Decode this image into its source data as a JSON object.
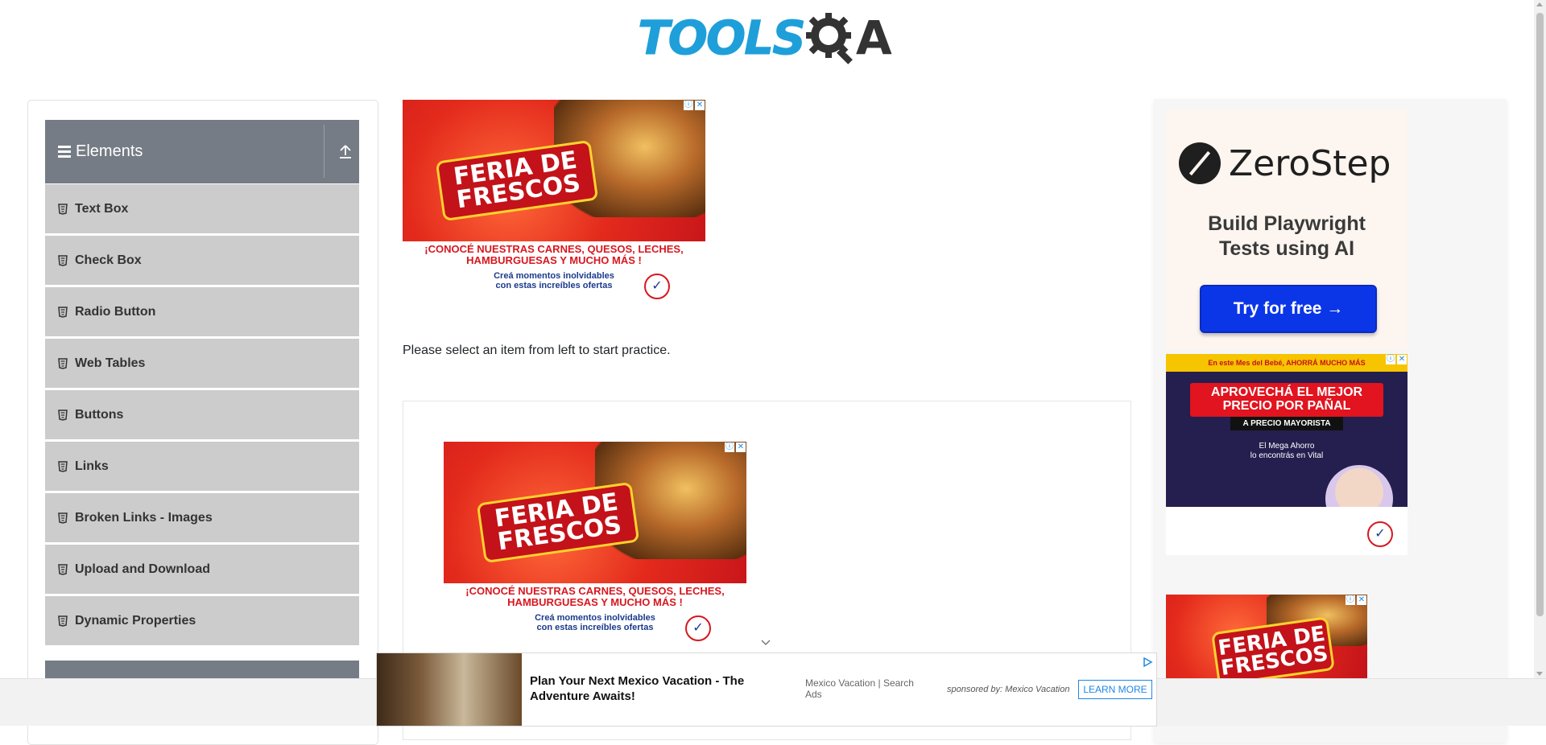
{
  "header": {
    "logo_tools": "TOOLS",
    "logo_qa": "A",
    "logo_alt": "TOOLSQA"
  },
  "sidebar": {
    "group_title": "Elements",
    "items": [
      {
        "label": "Text Box"
      },
      {
        "label": "Check Box"
      },
      {
        "label": "Radio Button"
      },
      {
        "label": "Web Tables"
      },
      {
        "label": "Buttons"
      },
      {
        "label": "Links"
      },
      {
        "label": "Broken Links - Images"
      },
      {
        "label": "Upload and Download"
      },
      {
        "label": "Dynamic Properties"
      }
    ]
  },
  "main": {
    "practice_text": "Please select an item from left to start practice."
  },
  "ads": {
    "feria": {
      "title_line1": "FERIA DE",
      "title_line2": "FRESCOS",
      "tagline": "¡CONOCÉ NUESTRAS CARNES, QUESOS, LECHES, HAMBURGUESAS Y MUCHO MÁS !",
      "subline_1": "Creá momentos inolvidables",
      "subline_2": "con estas increíbles ofertas"
    },
    "zerostep": {
      "name": "ZeroStep",
      "tagline_1": "Build Playwright",
      "tagline_2": "Tests using AI",
      "button": "Try for free →"
    },
    "bebe": {
      "top": "En este Mes del Bebé, AHORRÁ MUCHO MÁS",
      "headline_1": "APROVECHÁ EL MEJOR",
      "headline_2": "PRECIO POR PAÑAL",
      "sub": "A PRECIO MAYORISTA",
      "text_1": "El Mega Ahorro",
      "text_2": "lo encontrás en Vital"
    },
    "bottom": {
      "headline": "Plan Your Next Mexico Vacation - The Adventure Awaits!",
      "search": "Mexico Vacation | Search Ads",
      "sponsor": "sponsored by: Mexico Vacation",
      "cta": "LEARN MORE"
    }
  },
  "colors": {
    "accent_blue": "#1e9fda",
    "sidebar_header": "#757c85",
    "menu_item_bg": "#cccccc",
    "zerostep_button": "#0b36e8"
  }
}
